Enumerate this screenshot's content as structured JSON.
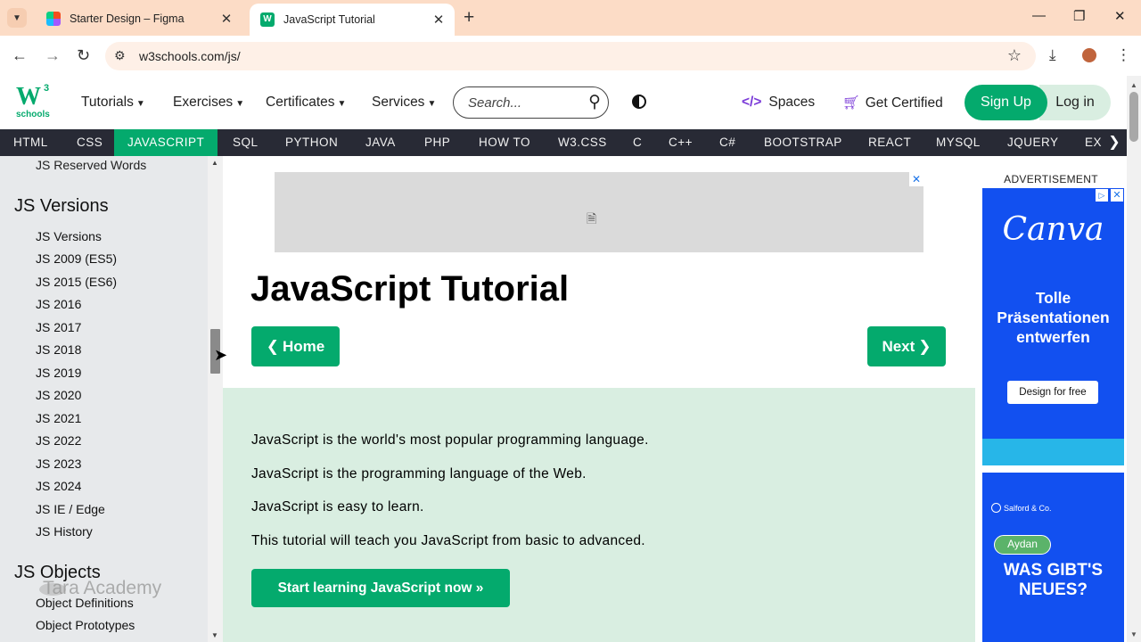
{
  "browser": {
    "tabs": [
      {
        "title": "Starter Design – Figma",
        "icon": "figma-icon"
      },
      {
        "title": "JavaScript Tutorial",
        "icon": "w3schools-icon"
      }
    ],
    "url": "w3schools.com/js/"
  },
  "w3nav": {
    "logo_main": "W",
    "logo_sup": "3",
    "logo_sub": "schools",
    "menus": [
      "Tutorials",
      "Exercises",
      "Certificates",
      "Services"
    ],
    "search_placeholder": "Search...",
    "spaces": "Spaces",
    "get_certified": "Get Certified",
    "sign_up": "Sign Up",
    "log_in": "Log in"
  },
  "subjects": [
    "HTML",
    "CSS",
    "JAVASCRIPT",
    "SQL",
    "PYTHON",
    "JAVA",
    "PHP",
    "HOW TO",
    "W3.CSS",
    "C",
    "C++",
    "C#",
    "BOOTSTRAP",
    "REACT",
    "MYSQL",
    "JQUERY",
    "EX"
  ],
  "active_subject": "JAVASCRIPT",
  "sidebar": {
    "top_link": "JS Reserved Words",
    "versions_heading": "JS Versions",
    "version_links": [
      "JS Versions",
      "JS 2009 (ES5)",
      "JS 2015 (ES6)",
      "JS 2016",
      "JS 2017",
      "JS 2018",
      "JS 2019",
      "JS 2020",
      "JS 2021",
      "JS 2022",
      "JS 2023",
      "JS 2024",
      "JS IE / Edge",
      "JS History"
    ],
    "objects_heading": "JS Objects",
    "object_links": [
      "Object Definitions",
      "Object Prototypes"
    ],
    "watermark": "Tara Academy"
  },
  "main": {
    "title": "JavaScript Tutorial",
    "home_button": "Home",
    "next_button": "Next",
    "intro": [
      "JavaScript is the world's most popular programming language.",
      "JavaScript is the programming language of the Web.",
      "JavaScript is easy to learn.",
      "This tutorial will teach you JavaScript from basic to advanced."
    ],
    "start_button": "Start learning JavaScript now »"
  },
  "ad": {
    "label": "ADVERTISEMENT",
    "brand": "Canva",
    "headline": "Tolle Präsentationen entwerfen",
    "cta": "Design for free",
    "sponsor": "Salford & Co.",
    "pill": "Aydan",
    "tagline": "WAS GIBT'S NEUES?"
  },
  "colors": {
    "accent": "#04aa6d",
    "subject_bar": "#282a35",
    "sidebar": "#e7e9eb",
    "intro_bg": "#d9eee1",
    "tabstrip": "#fcdcc6",
    "canva_blue": "#1250f0"
  }
}
